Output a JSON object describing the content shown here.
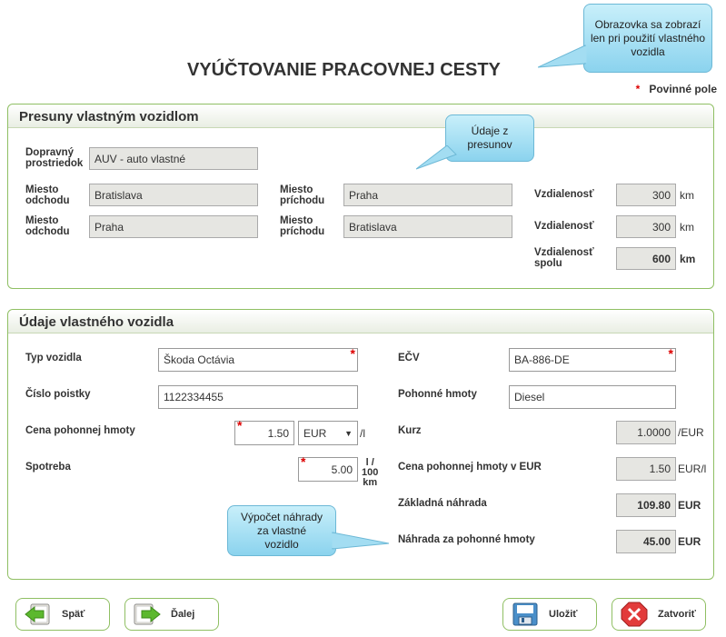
{
  "header": {
    "title": "VYÚČTOVANIE PRACOVNEJ CESTY",
    "required_star": "*",
    "required_label": "Povinné pole"
  },
  "callouts": {
    "screen_note": "Obrazovka sa zobrazí len pri použití vlastného vozidla",
    "trips_note": "Údaje z presunov",
    "calc_note": "Výpočet náhrady za vlastné vozidlo"
  },
  "trips": {
    "title": "Presuny vlastným vozidlom",
    "transport_label": "Dopravný prostriedok",
    "transport_value": "AUV - auto vlastné",
    "departure_label": "Miesto odchodu",
    "arrival_label": "Miesto príchodu",
    "distance_label": "Vzdialenosť",
    "distance_total_label": "Vzdialenosť spolu",
    "rows": [
      {
        "from": "Bratislava",
        "to": "Praha",
        "distance": "300",
        "unit": "km"
      },
      {
        "from": "Praha",
        "to": "Bratislava",
        "distance": "300",
        "unit": "km"
      }
    ],
    "total_distance": "600",
    "total_unit": "km"
  },
  "vehicle": {
    "title": "Údaje vlastného vozidla",
    "type_label": "Typ vozidla",
    "type_value": "Škoda Octávia",
    "plate_label": "EČV",
    "plate_value": "BA-886-DE",
    "policy_label": "Číslo poistky",
    "policy_value": "1122334455",
    "fuel_label": "Pohonné hmoty",
    "fuel_value": "Diesel",
    "fuel_price_label": "Cena pohonnej hmoty",
    "fuel_price_value": "1.50",
    "currency_value": "EUR",
    "per_liter": "/l",
    "rate_label": "Kurz",
    "rate_value": "1.0000",
    "rate_unit": "/EUR",
    "consumption_label": "Spotreba",
    "consumption_value": "5.00",
    "consumption_unit_1": "l /",
    "consumption_unit_2": "100",
    "consumption_unit_3": "km",
    "fuel_price_eur_label": "Cena pohonnej hmoty v EUR",
    "fuel_price_eur_value": "1.50",
    "fuel_price_eur_unit": "EUR/l",
    "base_comp_label": "Základná náhrada",
    "base_comp_value": "109.80",
    "base_comp_unit": "EUR",
    "fuel_comp_label": "Náhrada za pohonné hmoty",
    "fuel_comp_value": "45.00",
    "fuel_comp_unit": "EUR",
    "star": "*"
  },
  "buttons": {
    "back": "Späť",
    "next": "Ďalej",
    "save": "Uložiť",
    "close": "Zatvoriť"
  }
}
